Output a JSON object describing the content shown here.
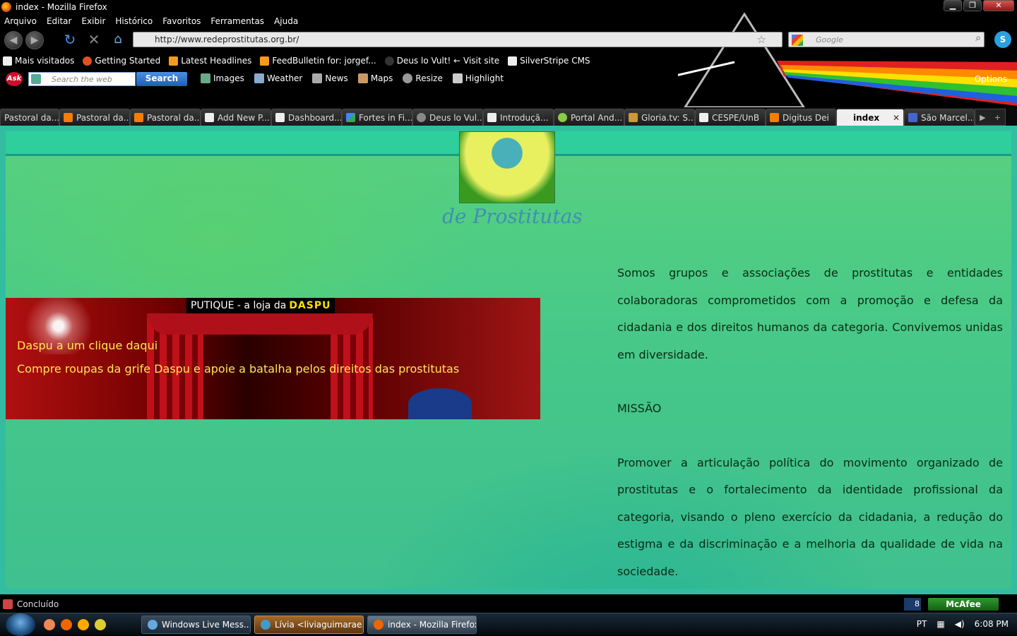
{
  "window": {
    "title": "index - Mozilla Firefox"
  },
  "menu": [
    "Arquivo",
    "Editar",
    "Exibir",
    "Histórico",
    "Favoritos",
    "Ferramentas",
    "Ajuda"
  ],
  "nav": {
    "url": "http://www.redeprostitutas.org.br/",
    "search_placeholder": "Google"
  },
  "bookmarks": [
    "Mais visitados",
    "Getting Started",
    "Latest Headlines",
    "FeedBulletin for: jorgef...",
    "Deus lo Vult! ← Visit site",
    "SilverStripe CMS"
  ],
  "ask": {
    "placeholder": "Search the web",
    "button": "Search",
    "links": [
      "Images",
      "Weather",
      "News",
      "Maps",
      "Resize",
      "Highlight"
    ],
    "options": "Options"
  },
  "tabs": [
    "Pastoral da...",
    "Pastoral da...",
    "Pastoral da...",
    "Add New P...",
    "Dashboard...",
    "Fortes in Fi...",
    "Deus lo Vul...",
    "Introduçã...",
    "Portal And...",
    "Gloria.tv: S...",
    "CESPE/UnB",
    "Digitus Dei",
    "index",
    "São Marcel..."
  ],
  "page": {
    "logo_text": "de Prostitutas",
    "banner_title": "PUTIQUE - a loja da",
    "banner_brand": "DASPU",
    "banner_line1": "Daspu a um clique daqui",
    "banner_line2": "Compre roupas da grife Daspu e apoie a batalha pelos direitos das prostitutas",
    "intro": "Somos grupos e associações de prostitutas e entidades colaboradoras comprometidos com a promoção e defesa da cidadania e dos direitos humanos da categoria. Convivemos unidas em diversidade.",
    "mission_heading": "MISSÃO",
    "mission": "Promover a articulação política do movimento organizado de prostitutas e o fortalecimento da identidade profissional da categoria, visando o pleno exercício da cidadania, a redução do estigma e da discriminação e a melhoria da qualidade de vida na sociedade."
  },
  "status": {
    "text": "Concluído",
    "count": "8",
    "mcafee": "McAfee"
  },
  "taskbar": {
    "buttons": [
      "Windows Live Mess...",
      "Lívia <liviaguimarae...",
      "index - Mozilla Firefox"
    ],
    "lang": "PT",
    "clock": "6:08 PM"
  }
}
